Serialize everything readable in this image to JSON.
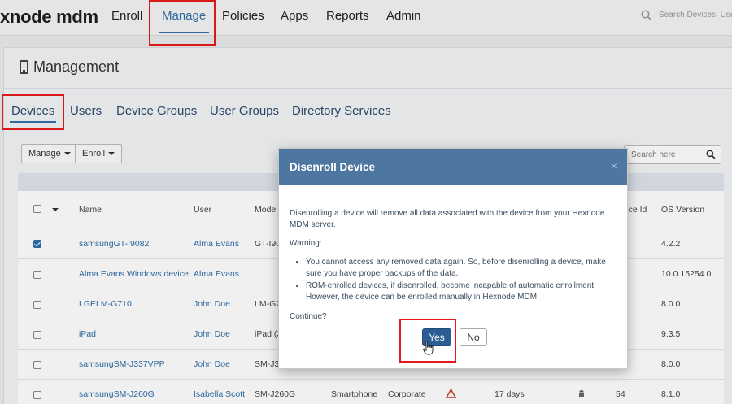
{
  "topnav": {
    "logo": "xnode mdm",
    "items": [
      {
        "label": "Enroll"
      },
      {
        "label": "Manage"
      },
      {
        "label": "Policies"
      },
      {
        "label": "Apps"
      },
      {
        "label": "Reports"
      },
      {
        "label": "Admin"
      }
    ],
    "search_placeholder": "Search Devices, Use"
  },
  "management": {
    "title": "Management",
    "tabs": [
      {
        "label": "Devices"
      },
      {
        "label": "Users"
      },
      {
        "label": "Device Groups"
      },
      {
        "label": "User Groups"
      },
      {
        "label": "Directory Services"
      }
    ],
    "manage_button": "Manage",
    "enroll_button": "Enroll",
    "search_placeholder": "Search here"
  },
  "table": {
    "headers": {
      "name": "Name",
      "user": "User",
      "model": "Model",
      "device_id": "vice Id",
      "os_version": "OS Version"
    },
    "rows": [
      {
        "name": "samsungGT-I9082",
        "user": "Alma Evans",
        "model": "GT-I90",
        "os": "4.2.2",
        "checked": true
      },
      {
        "name": "Alma Evans Windows device",
        "user": "Alma Evans",
        "model": "",
        "os": "10.0.15254.0",
        "checked": false
      },
      {
        "name": "LGELM-G710",
        "user": "John Doe",
        "model": "LM-G7",
        "os": "8.0.0",
        "checked": false
      },
      {
        "name": "iPad",
        "user": "John Doe",
        "model": "iPad (3",
        "os": "9.3.5",
        "checked": false
      },
      {
        "name": "samsungSM-J337VPP",
        "user": "John Doe",
        "model": "SM-J3",
        "os": "8.0.0",
        "checked": false
      },
      {
        "name": "samsungSM-J260G",
        "user": "Isabella Scott",
        "model": "SM-J260G",
        "os": "8.1.0",
        "checked": false,
        "type": "Smartphone",
        "ownership": "Corporate",
        "last_seen": "17 days",
        "device_id": "54"
      }
    ]
  },
  "modal": {
    "title": "Disenroll Device",
    "close": "×",
    "body": "Disenrolling a device will remove all data associated with the device from your Hexnode MDM server.",
    "warning_label": "Warning:",
    "warnings": [
      "You cannot access any removed data again. So, before disenrolling a device, make sure you have proper backups of the data.",
      "ROM-enrolled devices, if disenrolled, become incapable of automatic enrollment. However, the device can be enrolled manually in Hexnode MDM."
    ],
    "continue_label": "Continue?",
    "yes_label": "Yes",
    "no_label": "No"
  },
  "colors": {
    "accent": "#2f6ea8",
    "modal_header": "#4d77a1",
    "highlight": "#e51b1b"
  }
}
